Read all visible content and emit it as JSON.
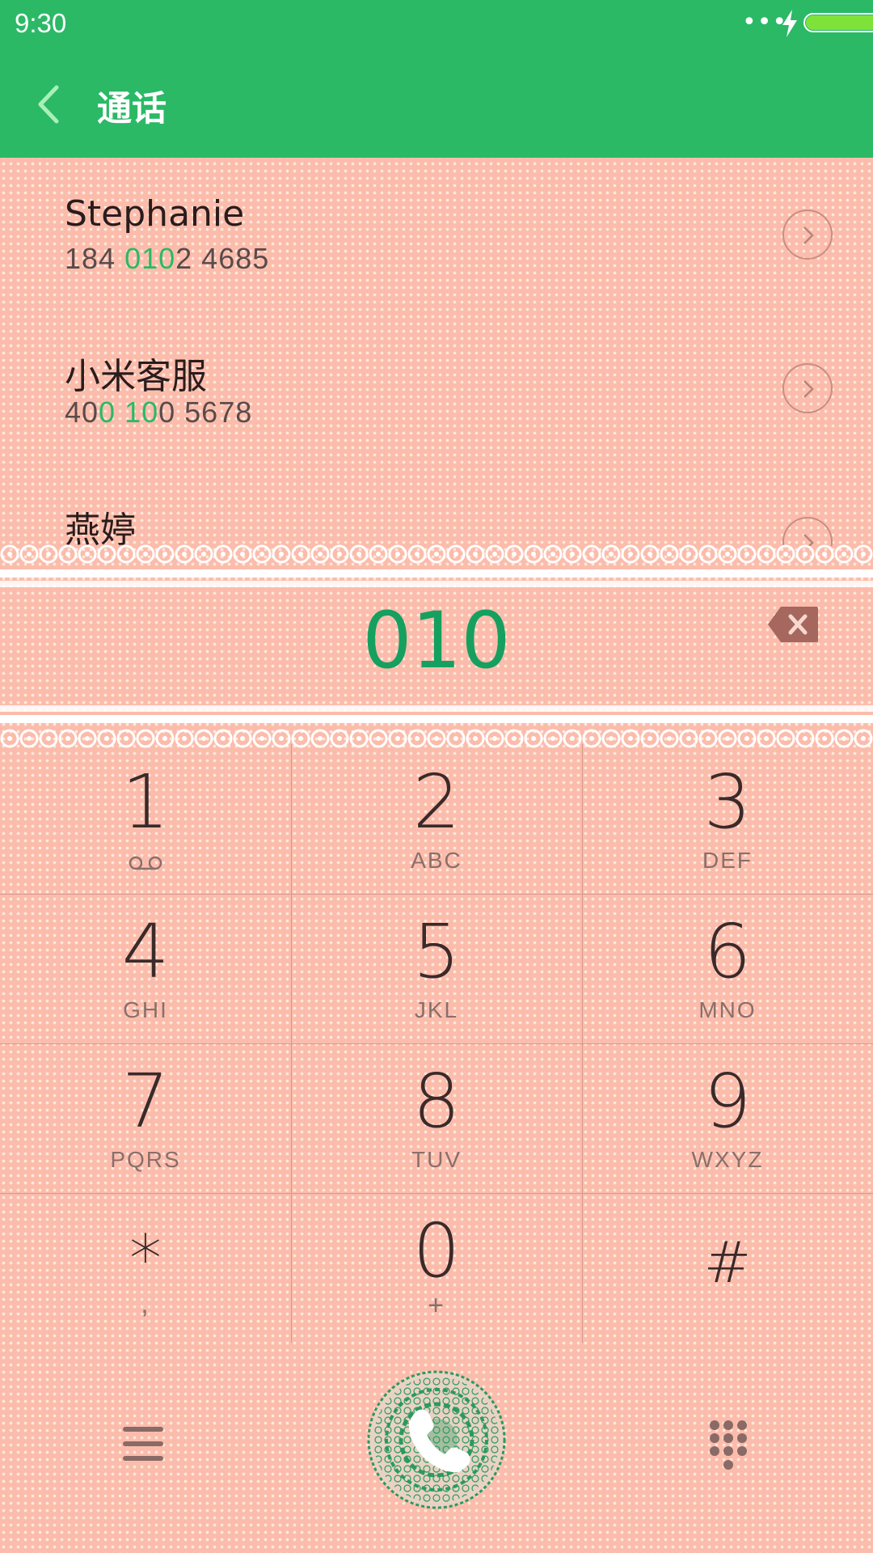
{
  "status_bar": {
    "time": "9:30",
    "signal_dots": "•••"
  },
  "header": {
    "title": "通话",
    "accent_color": "#2bb966"
  },
  "contacts": [
    {
      "name": "Stephanie",
      "number_parts": [
        "184  ",
        "010",
        "2  4685"
      ]
    },
    {
      "name": "小米客服",
      "number_parts": [
        "40",
        "0  10",
        "0  5678"
      ]
    },
    {
      "name": "燕婷",
      "number_parts": [
        "",
        "",
        ""
      ]
    }
  ],
  "dialer": {
    "input": "010"
  },
  "keys": [
    {
      "digit": "1",
      "letters": ""
    },
    {
      "digit": "2",
      "letters": "ABC"
    },
    {
      "digit": "3",
      "letters": "DEF"
    },
    {
      "digit": "4",
      "letters": "GHI"
    },
    {
      "digit": "5",
      "letters": "JKL"
    },
    {
      "digit": "6",
      "letters": "MNO"
    },
    {
      "digit": "7",
      "letters": "PQRS"
    },
    {
      "digit": "8",
      "letters": "TUV"
    },
    {
      "digit": "9",
      "letters": "WXYZ"
    },
    {
      "digit": "*",
      "letters": ","
    },
    {
      "digit": "0",
      "letters": "+"
    },
    {
      "digit": "#",
      "letters": ""
    }
  ],
  "icons": {
    "back": "chevron-left-icon",
    "delete": "backspace-icon",
    "voicemail": "voicemail-icon",
    "menu": "menu-icon",
    "call": "phone-icon",
    "dialpad": "dialpad-icon"
  }
}
